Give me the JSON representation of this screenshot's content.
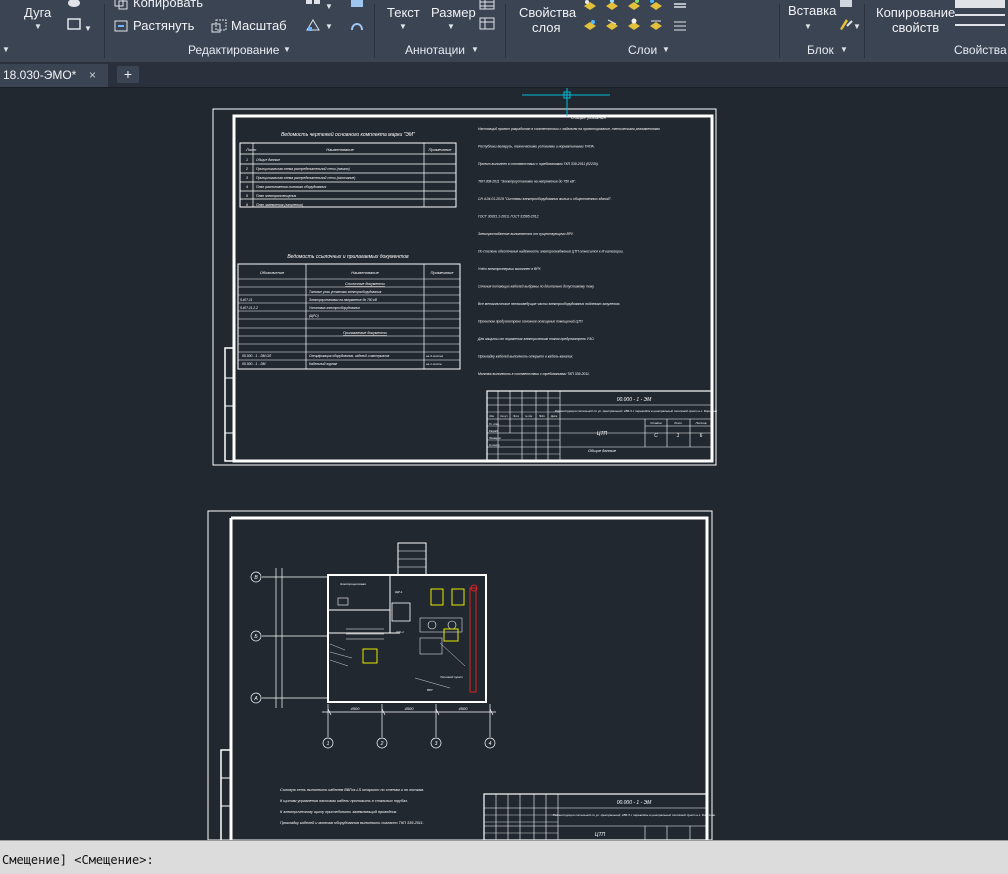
{
  "ribbon": {
    "draw": {
      "arc_label": "Дуга"
    },
    "modify": {
      "copy_label": "Копировать",
      "stretch_label": "Растянуть",
      "scale_label": "Масштаб",
      "title": "Редактирование"
    },
    "annotation": {
      "text_label": "Текст",
      "dimension_label": "Размер",
      "title": "Аннотации"
    },
    "layers": {
      "properties_line1": "Свойства",
      "properties_line2": "слоя",
      "title": "Слои"
    },
    "block": {
      "insert_label": "Вставка",
      "title": "Блок"
    },
    "properties": {
      "copy_line1": "Копирование",
      "copy_line2": "свойств",
      "title": "Свойства"
    }
  },
  "tabs": {
    "document": "18.030-ЭМО*",
    "close": "×",
    "new": "+"
  },
  "sheet1": {
    "list_title": "Ведомость чертежей основного комплекта марки \"ЭМ\"",
    "col_sheet": "Лист",
    "col_name": "Наименование",
    "col_note": "Примечание",
    "sheet_rows": [
      {
        "no": "1",
        "name": "Общие данные"
      },
      {
        "no": "2",
        "name": "Принципиальная схема распределительной сети (начало)"
      },
      {
        "no": "3",
        "name": "Принципиальная схема распределительной сети (окончание)"
      },
      {
        "no": "4",
        "name": "План расположения силового оборудования"
      },
      {
        "no": "5",
        "name": "План электроосвещения"
      },
      {
        "no": "6",
        "name": "План заземления (зануления)"
      }
    ],
    "refs_title": "Ведомость ссылочных и прилагаемых документов",
    "col_designation": "Обозначение",
    "col_ref_name": "Наименование",
    "col_ref_note": "Примечание",
    "refs_heading": "Ссылочные документы",
    "refs_rows": [
      {
        "des": "",
        "name": "Типовые узлы установки электрооборудования"
      },
      {
        "des": "5.407-11",
        "name": "Электроустановки на напряжение до 750 кВ"
      },
      {
        "des": "5.407-11.2-2",
        "name": "Установка электрооборудования"
      },
      {
        "des": "",
        "name": "(ЩРО)"
      }
    ],
    "attached_heading": "Прилагаемые документы",
    "attached_rows": [
      {
        "des": "00.000 - 1 - ЭМ.ОЛ",
        "name": "Спецификация оборудования, изделий и материалов",
        "note": "на 3 листах"
      },
      {
        "des": "00.000 - 1 - ЭМ",
        "name": "Кабельный журнал",
        "note": "на 1 листе"
      }
    ],
    "notes_heading": "Общие указания",
    "notes_lines": [
      "Настоящий проект разработан в соответствии с заданием на проектирование, техническими регламентами",
      "Республики Беларусь, техническими условиями и нормативными ТНПА.",
      "Проект выполнен в соответствии с требованиями ТКП 339-2011 (02230).",
      "ТКП 308-2011 \"Электроустановки на напряжение до 750 кВ\".",
      "СН 4.04.01-2019 \"Системы электрооборудования жилых и общественных зданий\".",
      "ГОСТ 30331.1-2013, ГОСТ 31565-2012.",
      "Электроснабжение выполняется от существующего ВРУ.",
      "По степени обеспечения надёжности электроснабжения ЦТП относится к III категории.",
      "Учёт электроэнергии выполнен в ВРУ.",
      "Сечения питающих кабелей выбраны по длительно допустимому току.",
      "Все металлические нетоковедущие части электрооборудования подлежат занулению.",
      "Проектом предусмотрено основное освещение помещений ЦТП.",
      "Для защиты от поражения электрическим током предусмотрено УЗО.",
      "Прокладку кабелей выполнить открыто в кабель-каналах.",
      "Монтаж выполнить в соответствии с требованиями ТКП 339-2011."
    ],
    "stamp_code": "00.000 - 1 - ЭМ",
    "stamp_title": "Реконструкция котельной по ул. Центральной, 28Б-5 с переводом в центральный тепловой пункт в г. Борисове",
    "stamp_object": "ЦТП",
    "stamp_sheet_name": "Общие данные",
    "stamp_stage_label": "Стадия",
    "stamp_sheet_label": "Лист",
    "stamp_sheets_label": "Листов",
    "stamp_stage": "С",
    "stamp_sheet": "1",
    "stamp_sheets": "6",
    "stamp_rows": [
      "Изм.",
      "Кол.уч",
      "Лист",
      "№ док.",
      "Подп.",
      "Дата"
    ],
    "stamp_roles": [
      "Гл. спец.",
      "Разраб.",
      "Проверил",
      "Н.контр."
    ]
  },
  "sheet2": {
    "axes_rows": [
      "В",
      "Б",
      "А"
    ],
    "axes_cols": [
      "1",
      "2",
      "3",
      "4"
    ],
    "dims": [
      "4500",
      "4500",
      "4500"
    ],
    "room_labels": [
      "Электрощитовая",
      "ЩР-1",
      "ЩО-1",
      "Тепловой пункт",
      "ВРУ"
    ],
    "notes_lines": [
      "Силовую сеть выполнить кабелем ВВГнг-LS открыто по стенам и по лоткам.",
      "К щитам управления насосами кабели проложить в стальных трубах.",
      "К электрическому щиту присоединить заземляющий проводник.",
      "Прокладку кабелей и монтаж оборудования выполнить согласно ТКП 339-2011."
    ],
    "stamp_code": "00.000 - 1 - ЭМ",
    "stamp_title": "Реконструкция котельной по ул. Центральной, 28Б-5 с переводом в центральный тепловой пункт в г. Борисове",
    "stamp_object": "ЦТП"
  },
  "command": {
    "text": "Смещение] <Смещение>:"
  },
  "colors": {
    "canvas_bg": "#212830",
    "ribbon_bg": "#3b4453",
    "drawing_lines": "#ffffff",
    "crosshair": "#00bcd4",
    "yellow": "#e8e800",
    "red": "#e02020"
  },
  "icons": [
    "arc-icon",
    "copy-icon",
    "stretch-icon",
    "scale-icon",
    "text-icon",
    "dimension-icon",
    "layer-icon",
    "insert-icon",
    "match-properties-icon",
    "close-icon",
    "plus-icon",
    "chevron-down-icon"
  ]
}
